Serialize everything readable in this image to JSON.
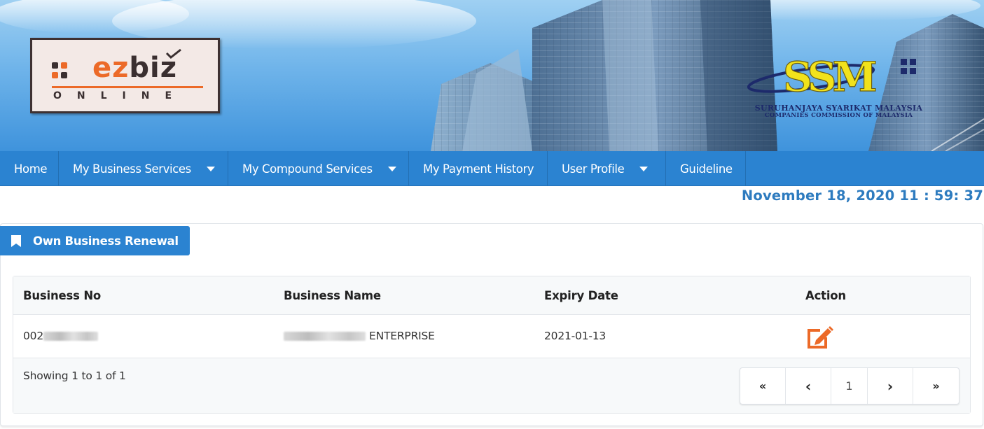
{
  "header": {
    "logo": {
      "brand_left": "ez",
      "brand_right": "biz",
      "brand_sub": "ONLINE"
    },
    "ssm": {
      "mark": "SSM",
      "name": "SURUHANJAYA SYARIKAT MALAYSIA",
      "sub": "COMPANIES COMMISSION OF MALAYSIA"
    }
  },
  "nav": {
    "items": [
      {
        "label": "Home",
        "dropdown": false
      },
      {
        "label": "My Business Services",
        "dropdown": true
      },
      {
        "label": "My Compound Services",
        "dropdown": true
      },
      {
        "label": "My Payment History",
        "dropdown": false
      },
      {
        "label": "User Profile",
        "dropdown": true
      },
      {
        "label": "Guideline",
        "dropdown": false
      }
    ]
  },
  "clock": {
    "text": "November 18, 2020 11 : 59: 37"
  },
  "panel": {
    "title": "Own Business Renewal",
    "icon": "bookmark-icon",
    "table": {
      "columns": [
        "Business No",
        "Business Name",
        "Expiry Date",
        "Action"
      ],
      "rows": [
        {
          "business_no": "002",
          "business_name": "ENTERPRISE",
          "expiry_date": "2021-01-13",
          "action_icon": "edit-icon"
        }
      ]
    },
    "showing": "Showing 1 to 1 of 1",
    "pagination": {
      "first": "«",
      "prev": "‹",
      "page": "1",
      "next": "›",
      "last": "»"
    }
  },
  "colors": {
    "nav": "#2b83d1",
    "accent_orange": "#ec6a28",
    "clock": "#2d7bbf",
    "ssm_yellow": "#f2e21b",
    "ssm_navy": "#1d2a6b"
  }
}
